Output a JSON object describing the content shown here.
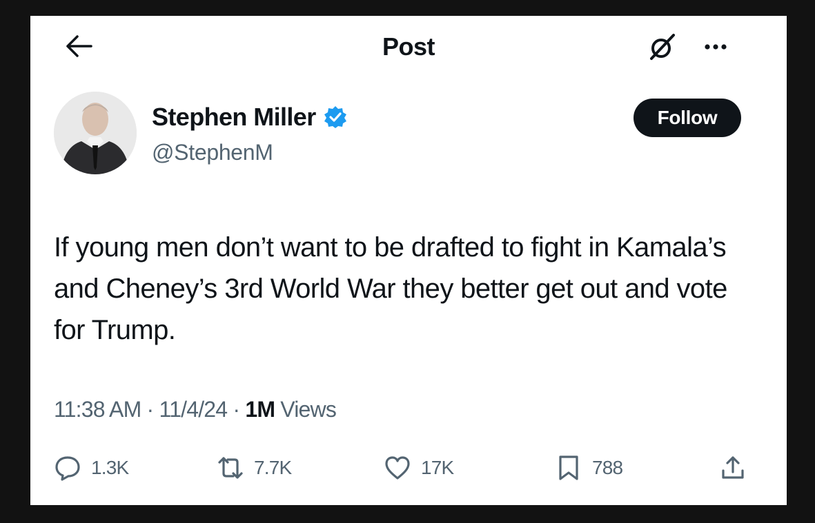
{
  "header": {
    "title": "Post"
  },
  "author": {
    "name": "Stephen Miller",
    "handle": "@StephenM",
    "verified": true,
    "verified_color": "#1d9bf0"
  },
  "follow_label": "Follow",
  "post": {
    "text": "If young men don’t want to be drafted to fight in Kamala’s and Cheney’s 3rd World War they better get out and vote for Trump.",
    "time": "11:38 AM",
    "date": "11/4/24",
    "views_count": "1M",
    "views_label": "Views"
  },
  "stats": {
    "replies": "1.3K",
    "reposts": "7.7K",
    "likes": "17K",
    "bookmarks": "788"
  },
  "icons": [
    "back-arrow-icon",
    "grok-icon",
    "more-icon",
    "verified-badge-icon",
    "reply-icon",
    "repost-icon",
    "like-icon",
    "bookmark-icon",
    "share-icon"
  ]
}
